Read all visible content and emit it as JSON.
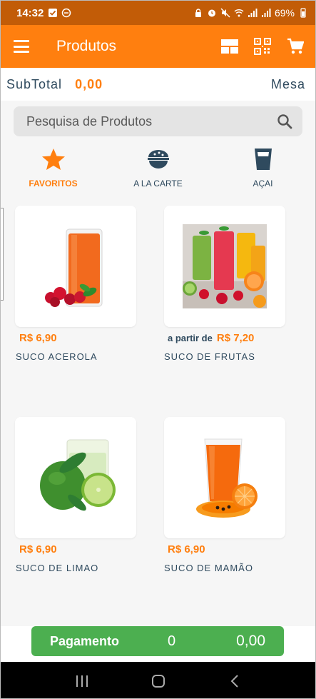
{
  "status": {
    "time": "14:32",
    "battery": "69%"
  },
  "appbar": {
    "title": "Produtos",
    "icons": [
      "menu-icon",
      "layout-icon",
      "qr-code-icon",
      "cart-icon"
    ]
  },
  "summary": {
    "subtotal_label": "SubTotal",
    "subtotal_value": "0,00",
    "mesa_label": "Mesa"
  },
  "search": {
    "placeholder": "Pesquisa de Produtos"
  },
  "categories": [
    {
      "label": "FAVORITOS",
      "icon": "star-icon",
      "active": true
    },
    {
      "label": "A LA CARTE",
      "icon": "food-bowl-icon",
      "active": false
    },
    {
      "label": "AÇAI",
      "icon": "cup-icon",
      "active": false
    }
  ],
  "products": [
    {
      "price_prefix": "",
      "price": "R$ 6,90",
      "name": "SUCO ACEROLA",
      "image": "acerola-juice-image"
    },
    {
      "price_prefix": "a partir de",
      "price": "R$ 7,20",
      "name": "SUCO DE FRUTAS",
      "image": "fruit-juices-image"
    },
    {
      "price_prefix": "",
      "price": "R$ 6,90",
      "name": "SUCO DE LIMAO",
      "image": "lime-juice-image"
    },
    {
      "price_prefix": "",
      "price": "R$ 6,90",
      "name": "SUCO DE MAMÃO",
      "image": "papaya-juice-image"
    }
  ],
  "payment": {
    "label": "Pagamento",
    "count": "0",
    "total": "0,00"
  },
  "colors": {
    "status_bar": "#c25c07",
    "primary": "#ff7f0f",
    "text_dark": "#2f4a5e",
    "pay_green": "#4caf50"
  }
}
